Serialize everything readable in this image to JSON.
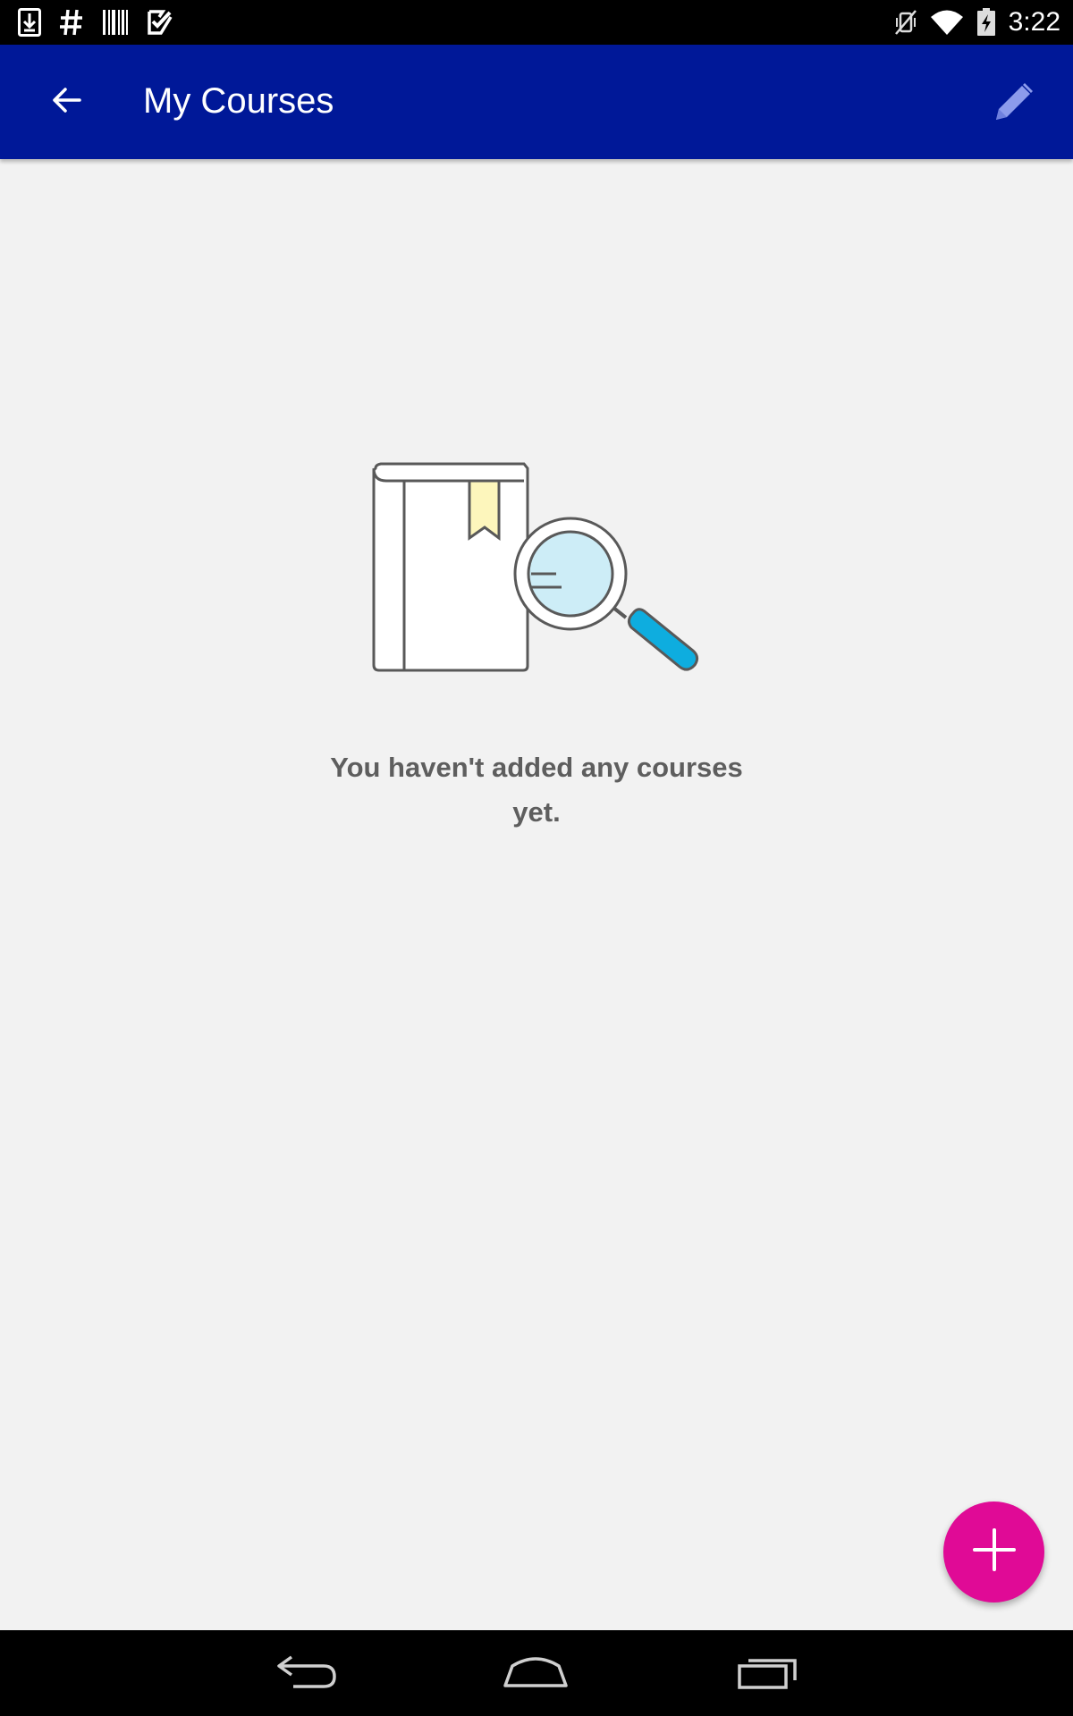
{
  "status_bar": {
    "time": "3:22",
    "left_icons": [
      "download-icon",
      "hash-icon",
      "barcode-icon",
      "tasks-check-icon"
    ],
    "right_icons": [
      "vibrate-mute-icon",
      "wifi-icon",
      "battery-charging-icon"
    ]
  },
  "app_bar": {
    "title": "My Courses",
    "back_icon": "arrow-back-icon",
    "edit_icon": "pencil-icon",
    "background_color": "#001898"
  },
  "empty_state": {
    "message": "You haven't added any courses yet.",
    "illustration": "book-magnifier-illustration"
  },
  "fab": {
    "icon": "plus-icon",
    "color": "#e00a96"
  },
  "nav_bar": {
    "buttons": [
      "nav-back-icon",
      "nav-home-icon",
      "nav-recents-icon"
    ]
  }
}
